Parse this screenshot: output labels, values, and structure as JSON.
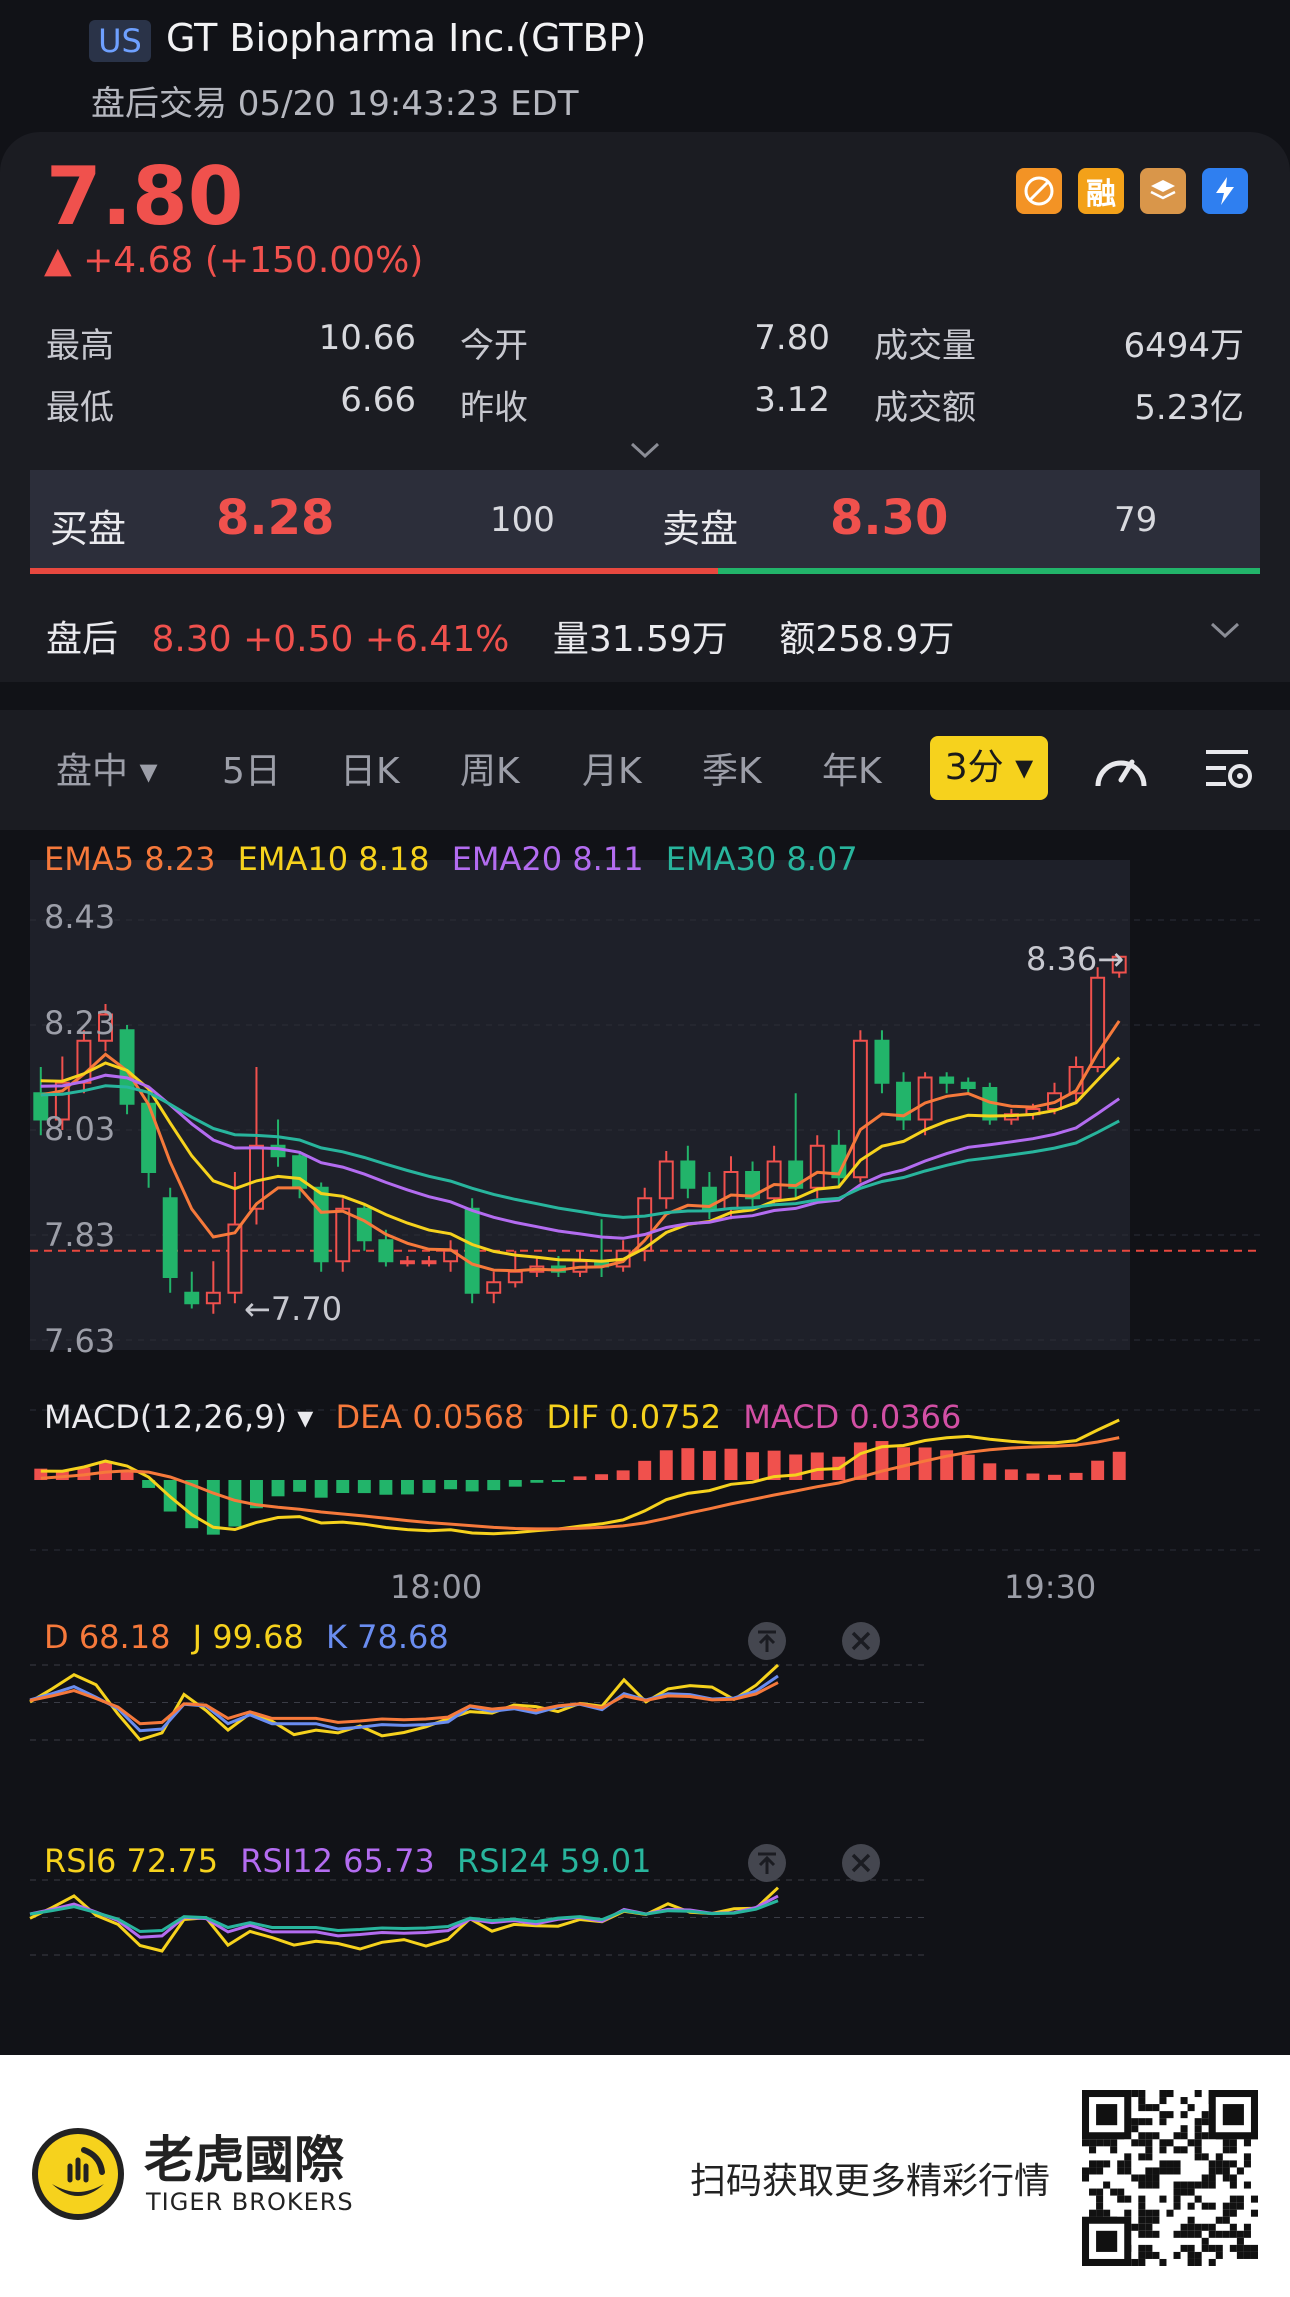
{
  "header": {
    "market_badge": "US",
    "title": "GT Biopharma Inc.(GTBP)",
    "subtitle": "盘后交易 05/20 19:43:23 EDT"
  },
  "quote": {
    "price": "7.80",
    "change": "▲ +4.68 (+150.00%)",
    "icons": [
      "no-ban-icon",
      "margin-icon",
      "options-icon",
      "lightning-icon"
    ],
    "icon_labels": {
      "margin": "融"
    },
    "stats": [
      {
        "label": "最高",
        "value": "10.66"
      },
      {
        "label": "今开",
        "value": "7.80"
      },
      {
        "label": "成交量",
        "value": "6494万"
      },
      {
        "label": "最低",
        "value": "6.66"
      },
      {
        "label": "昨收",
        "value": "3.12"
      },
      {
        "label": "成交额",
        "value": "5.23亿"
      }
    ]
  },
  "orderbook": {
    "bid_label": "买盘",
    "bid_price": "8.28",
    "bid_qty": "100",
    "ask_label": "卖盘",
    "ask_price": "8.30",
    "ask_qty": "79",
    "bid_ratio": 0.56
  },
  "after_hours": {
    "label": "盘后",
    "quote": "8.30 +0.50 +6.41%",
    "volume": "量31.59万",
    "amount": "额258.9万"
  },
  "tabs": [
    {
      "label": "盘中 ▾"
    },
    {
      "label": "5日"
    },
    {
      "label": "日K"
    },
    {
      "label": "周K"
    },
    {
      "label": "月K"
    },
    {
      "label": "季K"
    },
    {
      "label": "年K"
    }
  ],
  "active_tab": "3分 ▾",
  "colors": {
    "up": "#f0514d",
    "down": "#22b46a",
    "ema5": "#f6793b",
    "ema10": "#f6d21d",
    "ema20": "#b36cf0",
    "ema30": "#28b59d",
    "accent": "#f6d21d"
  },
  "indicators": {
    "ema": {
      "ema5": "EMA5 8.23",
      "ema10": "EMA10 8.18",
      "ema20": "EMA20 8.11",
      "ema30": "EMA30 8.07"
    },
    "macd": {
      "name": "MACD(12,26,9) ▾",
      "dea": "DEA 0.0568",
      "dif": "DIF 0.0752",
      "macd": "MACD 0.0366"
    },
    "kdj": {
      "d": "D 68.18",
      "j": "J 99.68",
      "k": "K 78.68"
    },
    "rsi": {
      "rsi6": "RSI6 72.75",
      "rsi12": "RSI12 65.73",
      "rsi24": "RSI24 59.01"
    }
  },
  "chart_data": {
    "type": "candlestick",
    "y_ticks": [
      "8.43",
      "8.23",
      "8.03",
      "7.83",
      "7.63"
    ],
    "ylim": [
      7.63,
      8.43
    ],
    "x_ticks": [
      "18:00",
      "19:30"
    ],
    "reference_line": 7.8,
    "low_marker": "7.70",
    "high_marker": "8.36",
    "candles": [
      [
        8.1,
        8.05,
        8.15,
        8.02
      ],
      [
        8.05,
        8.12,
        8.17,
        8.03
      ],
      [
        8.12,
        8.2,
        8.22,
        8.1
      ],
      [
        8.2,
        8.25,
        8.27,
        8.18
      ],
      [
        8.22,
        8.08,
        8.23,
        8.06
      ],
      [
        8.08,
        7.95,
        8.1,
        7.92
      ],
      [
        7.9,
        7.75,
        7.92,
        7.72
      ],
      [
        7.72,
        7.7,
        7.76,
        7.69
      ],
      [
        7.7,
        7.72,
        7.78,
        7.68
      ],
      [
        7.72,
        7.85,
        7.95,
        7.7
      ],
      [
        7.88,
        8.0,
        8.15,
        7.85
      ],
      [
        8.0,
        7.98,
        8.05,
        7.96
      ],
      [
        7.98,
        7.92,
        7.99,
        7.9
      ],
      [
        7.92,
        7.78,
        7.93,
        7.76
      ],
      [
        7.78,
        7.88,
        7.9,
        7.76
      ],
      [
        7.88,
        7.82,
        7.89,
        7.8
      ],
      [
        7.82,
        7.78,
        7.84,
        7.77
      ],
      [
        7.78,
        7.78,
        7.79,
        7.77
      ],
      [
        7.78,
        7.78,
        7.79,
        7.77
      ],
      [
        7.78,
        7.8,
        7.82,
        7.76
      ],
      [
        7.88,
        7.72,
        7.9,
        7.7
      ],
      [
        7.72,
        7.74,
        7.76,
        7.7
      ],
      [
        7.74,
        7.76,
        7.8,
        7.73
      ],
      [
        7.76,
        7.77,
        7.79,
        7.75
      ],
      [
        7.77,
        7.76,
        7.79,
        7.75
      ],
      [
        7.76,
        7.78,
        7.8,
        7.75
      ],
      [
        7.78,
        7.77,
        7.86,
        7.75
      ],
      [
        7.77,
        7.8,
        7.82,
        7.76
      ],
      [
        7.8,
        7.9,
        7.92,
        7.78
      ],
      [
        7.9,
        7.97,
        7.99,
        7.88
      ],
      [
        7.97,
        7.92,
        8.0,
        7.9
      ],
      [
        7.92,
        7.88,
        7.95,
        7.86
      ],
      [
        7.88,
        7.95,
        7.98,
        7.86
      ],
      [
        7.95,
        7.9,
        7.97,
        7.88
      ],
      [
        7.9,
        7.97,
        8.0,
        7.89
      ],
      [
        7.97,
        7.92,
        8.1,
        7.9
      ],
      [
        7.92,
        8.0,
        8.02,
        7.9
      ],
      [
        8.0,
        7.94,
        8.03,
        7.92
      ],
      [
        7.94,
        8.2,
        8.22,
        7.93
      ],
      [
        8.2,
        8.12,
        8.22,
        8.1
      ],
      [
        8.12,
        8.05,
        8.14,
        8.03
      ],
      [
        8.05,
        8.13,
        8.14,
        8.02
      ],
      [
        8.13,
        8.12,
        8.14,
        8.1
      ],
      [
        8.12,
        8.11,
        8.13,
        8.1
      ],
      [
        8.11,
        8.05,
        8.12,
        8.04
      ],
      [
        8.05,
        8.06,
        8.07,
        8.04
      ],
      [
        8.06,
        8.07,
        8.08,
        8.05
      ],
      [
        8.07,
        8.1,
        8.12,
        8.06
      ],
      [
        8.1,
        8.15,
        8.17,
        8.08
      ],
      [
        8.15,
        8.32,
        8.34,
        8.14
      ],
      [
        8.33,
        8.36,
        8.36,
        8.32
      ]
    ]
  },
  "footer": {
    "brand_cn": "老虎國際",
    "brand_en": "TIGER BROKERS",
    "slogan": "扫码获取更多精彩行情"
  }
}
